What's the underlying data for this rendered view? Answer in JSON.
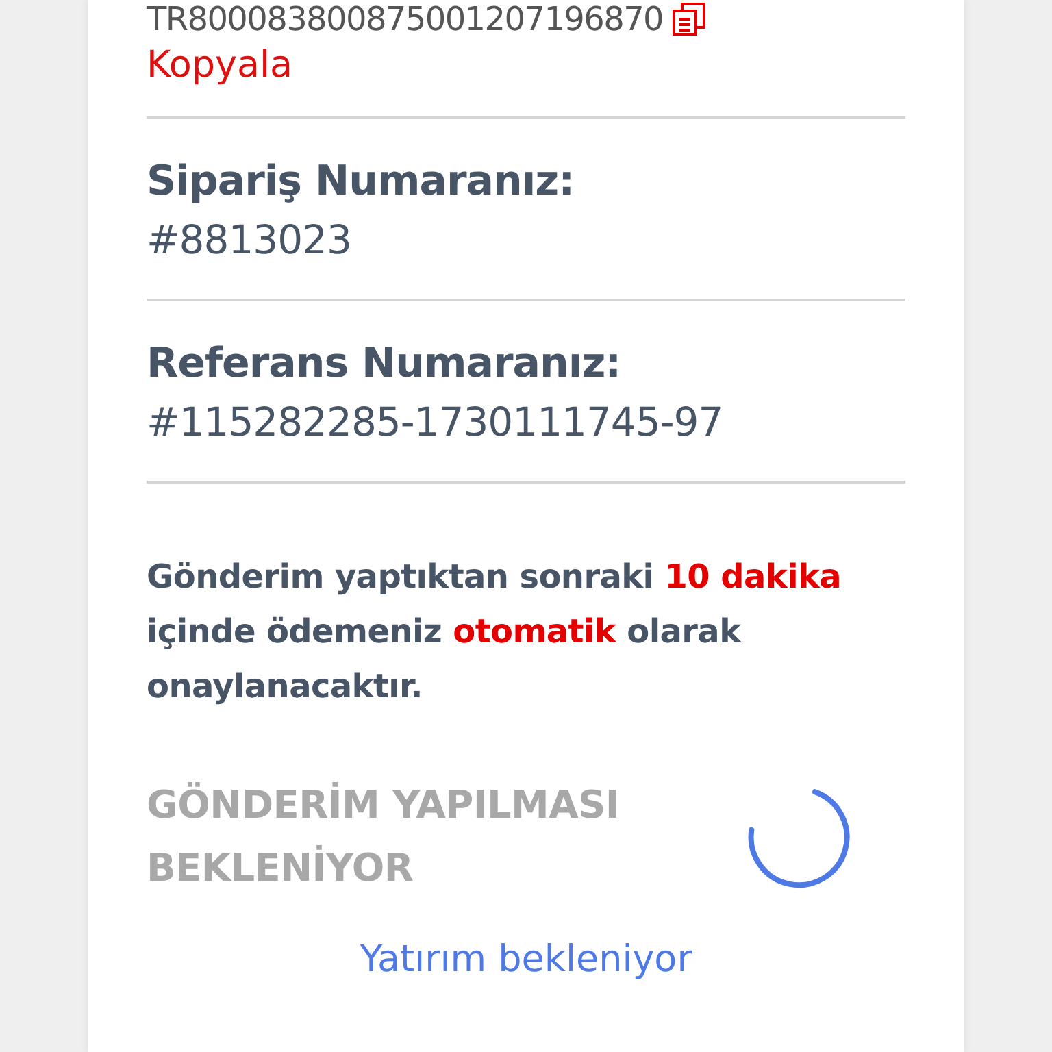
{
  "iban": {
    "value": "TR800083800875001207196870",
    "copy_label": "Kopyala"
  },
  "fields": [
    {
      "label": "Sipariş Numaranız:",
      "value": "#8813023"
    },
    {
      "label": "Referans Numaranız:",
      "value": "#115282285-1730111745-97"
    }
  ],
  "notice": [
    {
      "text": "Gönderim yaptıktan sonraki ",
      "highlight": false
    },
    {
      "text": "10 dakika",
      "highlight": true
    },
    {
      "text": " içinde ödemeniz ",
      "highlight": false
    },
    {
      "text": "otomatik",
      "highlight": true
    },
    {
      "text": " olarak onaylanacaktır.",
      "highlight": false
    }
  ],
  "waiting": {
    "title": "GÖNDERİM YAPILMASI BEKLENİYOR",
    "status": "Yatırım bekleniyor"
  }
}
